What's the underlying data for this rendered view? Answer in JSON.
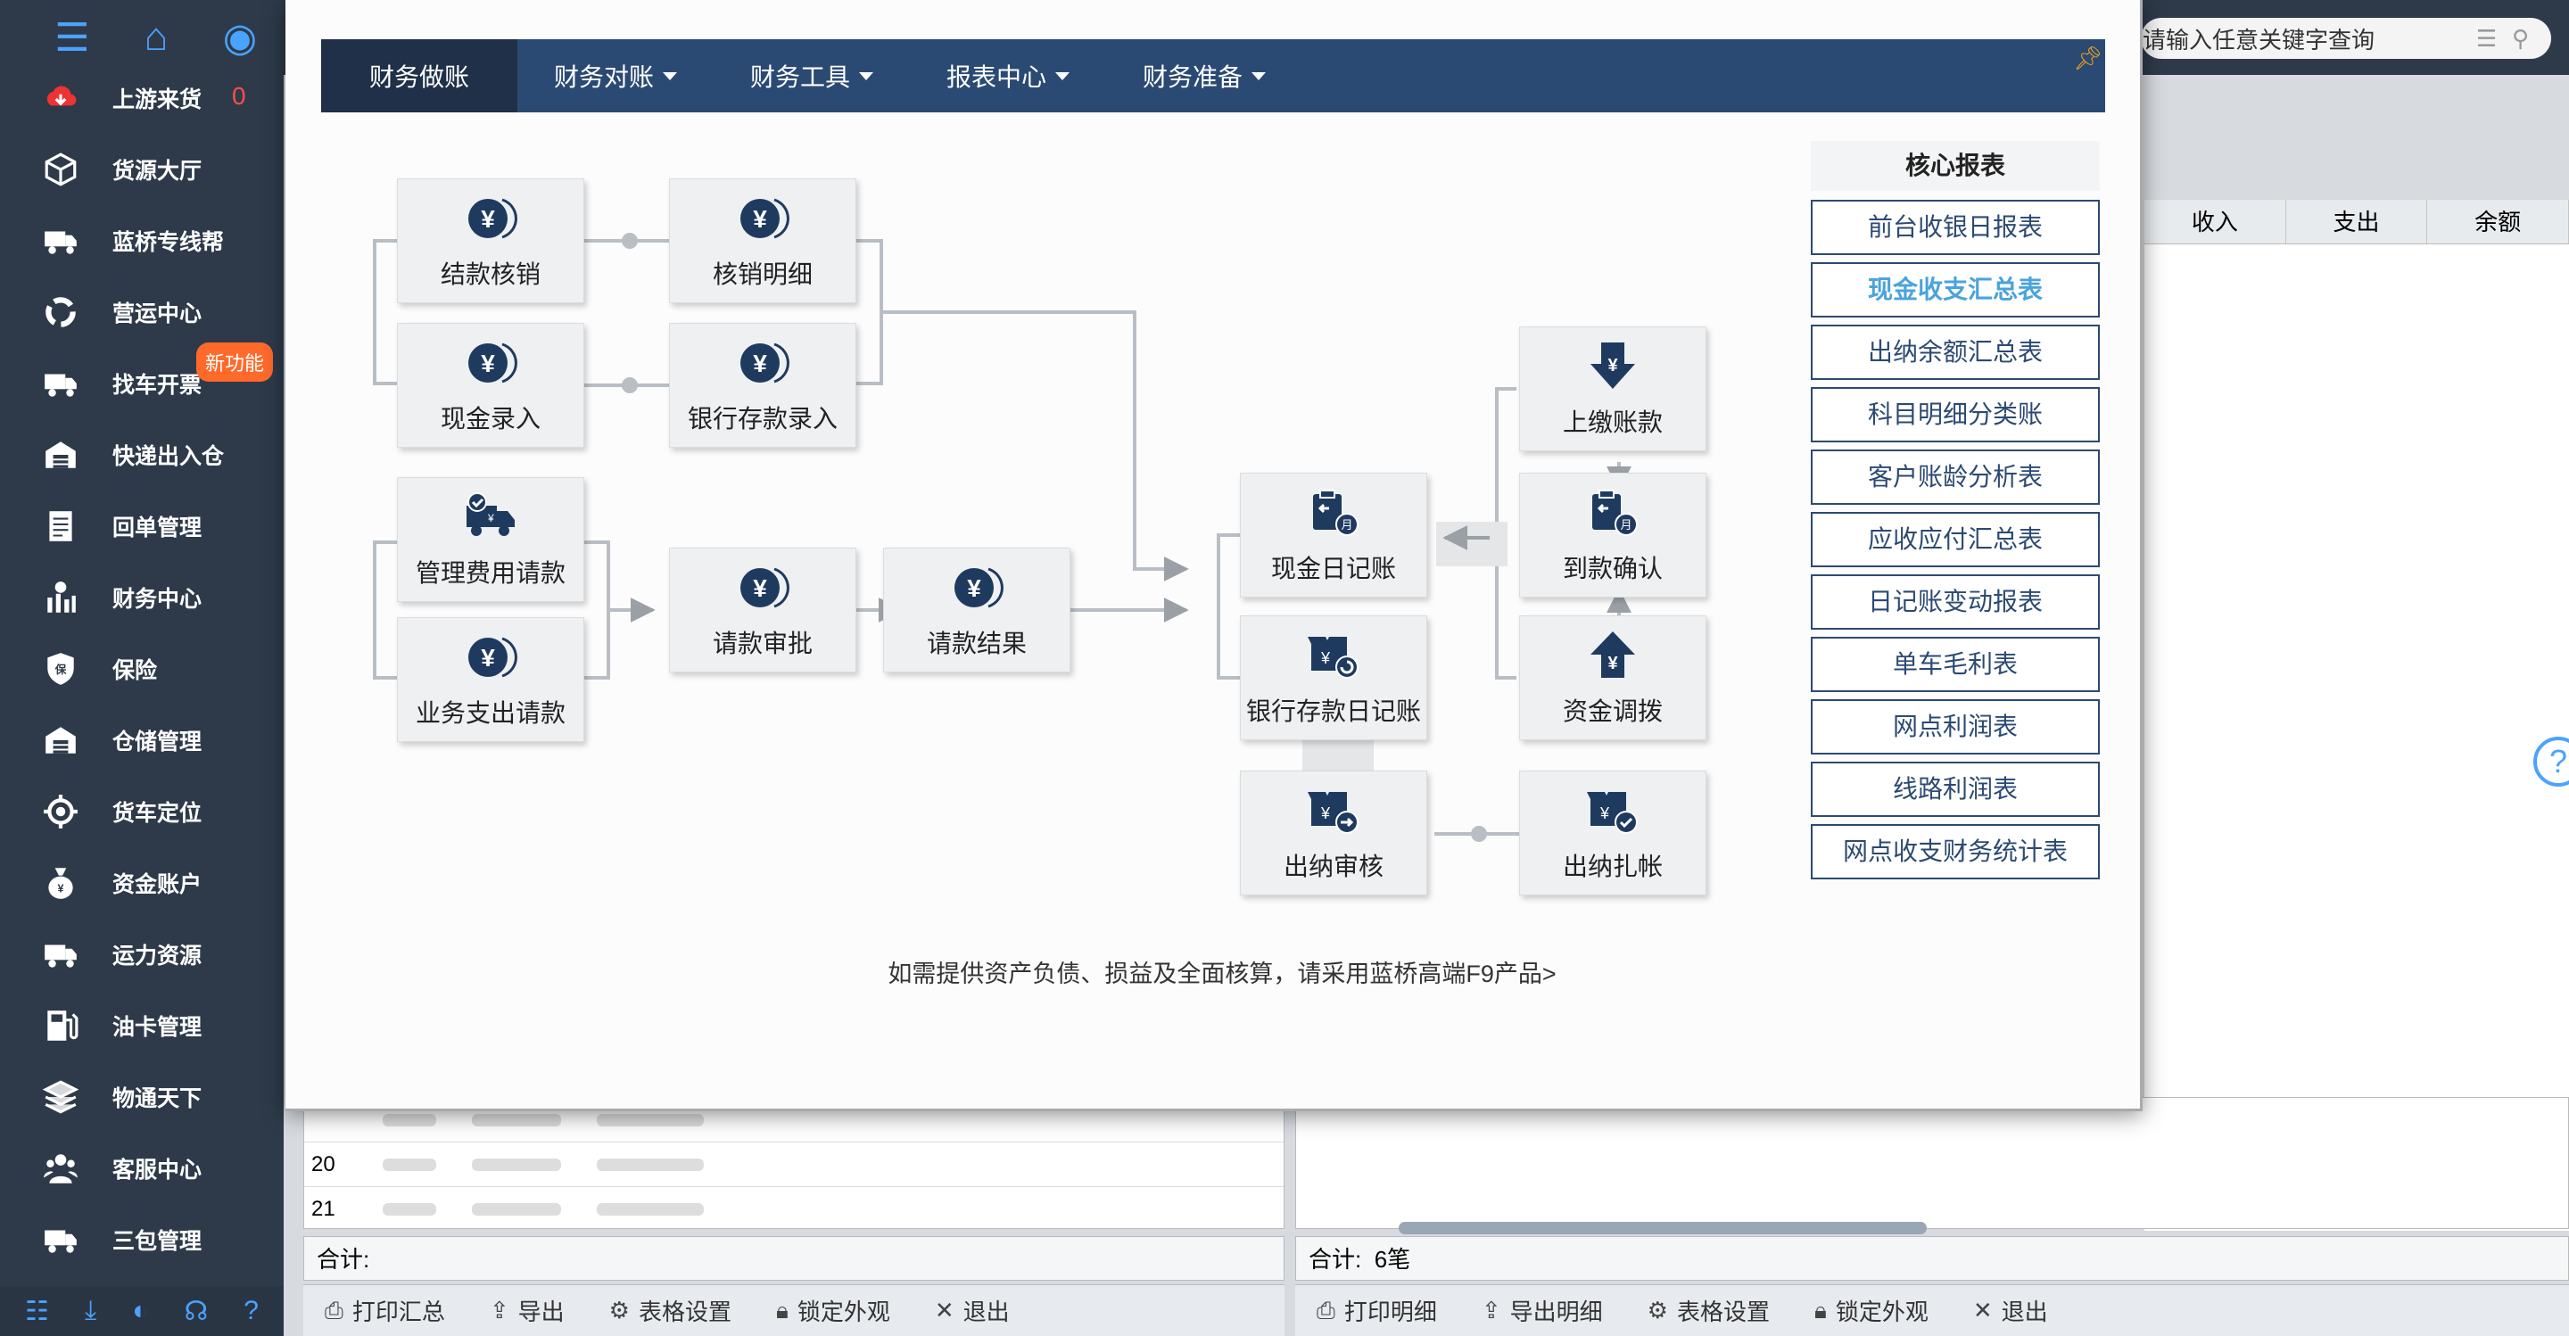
{
  "sidebar": {
    "items": [
      {
        "label": "上游来货",
        "icon": "cloud-download-icon"
      },
      {
        "label": "货源大厅",
        "icon": "cube-icon"
      },
      {
        "label": "蓝桥专线帮",
        "icon": "truck-icon"
      },
      {
        "label": "营运中心",
        "icon": "cycle-icon"
      },
      {
        "label": "找车开票",
        "icon": "truck-icon"
      },
      {
        "label": "快递出入仓",
        "icon": "warehouse-icon"
      },
      {
        "label": "回单管理",
        "icon": "document-icon"
      },
      {
        "label": "财务中心",
        "icon": "finance-chart-icon"
      },
      {
        "label": "保险",
        "icon": "shield-icon"
      },
      {
        "label": "仓储管理",
        "icon": "warehouse-icon"
      },
      {
        "label": "货车定位",
        "icon": "locate-icon"
      },
      {
        "label": "资金账户",
        "icon": "money-bag-icon"
      },
      {
        "label": "运力资源",
        "icon": "truck-icon"
      },
      {
        "label": "油卡管理",
        "icon": "fuel-icon"
      },
      {
        "label": "物通天下",
        "icon": "layers-icon"
      },
      {
        "label": "客服中心",
        "icon": "people-icon"
      },
      {
        "label": "三包管理",
        "icon": "truck-icon"
      }
    ],
    "count_upstream": "0",
    "new_badge": "新功能"
  },
  "search": {
    "placeholder": "请输入任意关键字查询"
  },
  "bg_table": {
    "headers": [
      "收入",
      "支出",
      "余额"
    ]
  },
  "bg_left_rows": [
    "20",
    "21"
  ],
  "bg_sum_left": "合计:",
  "bg_sum_right_label": "合计:",
  "bg_sum_right_value": "6笔",
  "toolbar_left": [
    "打印汇总",
    "导出",
    "表格设置",
    "锁定外观",
    "退出"
  ],
  "toolbar_right": [
    "打印明细",
    "导出明细",
    "表格设置",
    "锁定外观",
    "退出"
  ],
  "modal": {
    "menu": [
      {
        "label": "财务做账",
        "dropdown": false
      },
      {
        "label": "财务对账",
        "dropdown": true
      },
      {
        "label": "财务工具",
        "dropdown": true
      },
      {
        "label": "报表中心",
        "dropdown": true
      },
      {
        "label": "财务准备",
        "dropdown": true
      }
    ],
    "flow_nodes": {
      "jiekuan_hexiao": "结款核销",
      "hexiao_mingxi": "核销明细",
      "xianjin_luru": "现金录入",
      "yinhang_cunkuan_luru": "银行存款录入",
      "guanli_feiyong": "管理费用请款",
      "yewu_zhichu": "业务支出请款",
      "qingkuan_shenpi": "请款审批",
      "qingkuan_jieguo": "请款结果",
      "xianjin_rijizhang": "现金日记账",
      "yinhang_rijizhang": "银行存款日记账",
      "chuna_shenhe": "出纳审核",
      "chuna_zhazhang": "出纳扎帐",
      "shangjiao_zhangkuan": "上缴账款",
      "daokuan_queren": "到款确认",
      "zijin_diaobo": "资金调拨"
    },
    "core_title": "核心报表",
    "reports": [
      "前台收银日报表",
      "现金收支汇总表",
      "出纳余额汇总表",
      "科目明细分类账",
      "客户账龄分析表",
      "应收应付汇总表",
      "日记账变动报表",
      "单车毛利表",
      "网点利润表",
      "线路利润表",
      "网点收支财务统计表"
    ],
    "highlight_report_index": 1,
    "note": "如需提供资产负债、损益及全面核算，请采用蓝桥高端F9产品>"
  }
}
